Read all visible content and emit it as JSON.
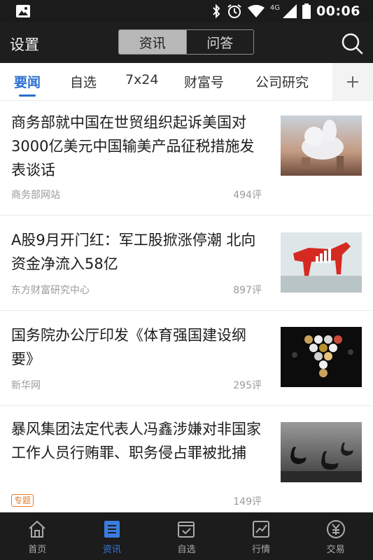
{
  "status_bar": {
    "network": "4G",
    "time": "00:06"
  },
  "header": {
    "settings_label": "设置",
    "segments": [
      {
        "label": "资讯",
        "active": true
      },
      {
        "label": "问答",
        "active": false
      }
    ],
    "search_icon": "search-icon"
  },
  "tabs": {
    "items": [
      {
        "label": "要闻",
        "active": true
      },
      {
        "label": "自选",
        "active": false
      },
      {
        "label": "7x24",
        "active": false
      },
      {
        "label": "财富号",
        "active": false
      },
      {
        "label": "公司研究",
        "active": false
      }
    ],
    "add_icon": "plus-icon"
  },
  "news": [
    {
      "title": "商务部就中国在世贸组织起诉美国对3000亿美元中国输美产品征税措施发表谈话",
      "source": "商务部网站",
      "comments": "494评",
      "thumb": "clouds-hand-photo"
    },
    {
      "title": "A股9月开门红：军工股掀涨停潮 北向资金净流入58亿",
      "source": "东方财富研究中心",
      "comments": "897评",
      "thumb": "red-bull-chart-photo"
    },
    {
      "title": "国务院办公厅印发《体育强国建设纲要》",
      "source": "新华网",
      "comments": "295评",
      "thumb": "hexagon-sports-photo"
    },
    {
      "title": "暴风集团法定代表人冯鑫涉嫌对非国家工作人员行贿罪、职务侵占罪被批捕",
      "badge": "专题",
      "comments": "149评",
      "thumb": "swans-photo"
    }
  ],
  "bottom_nav": [
    {
      "label": "首页",
      "icon": "home-icon",
      "active": false
    },
    {
      "label": "资讯",
      "icon": "news-icon",
      "active": true
    },
    {
      "label": "自选",
      "icon": "watchlist-icon",
      "active": false
    },
    {
      "label": "行情",
      "icon": "market-chart-icon",
      "active": false
    },
    {
      "label": "交易",
      "icon": "yuan-trade-icon",
      "active": false
    }
  ],
  "colors": {
    "accent": "#2a6fd1",
    "header_bg": "#1e1e1e",
    "badge": "#e07a2e"
  }
}
